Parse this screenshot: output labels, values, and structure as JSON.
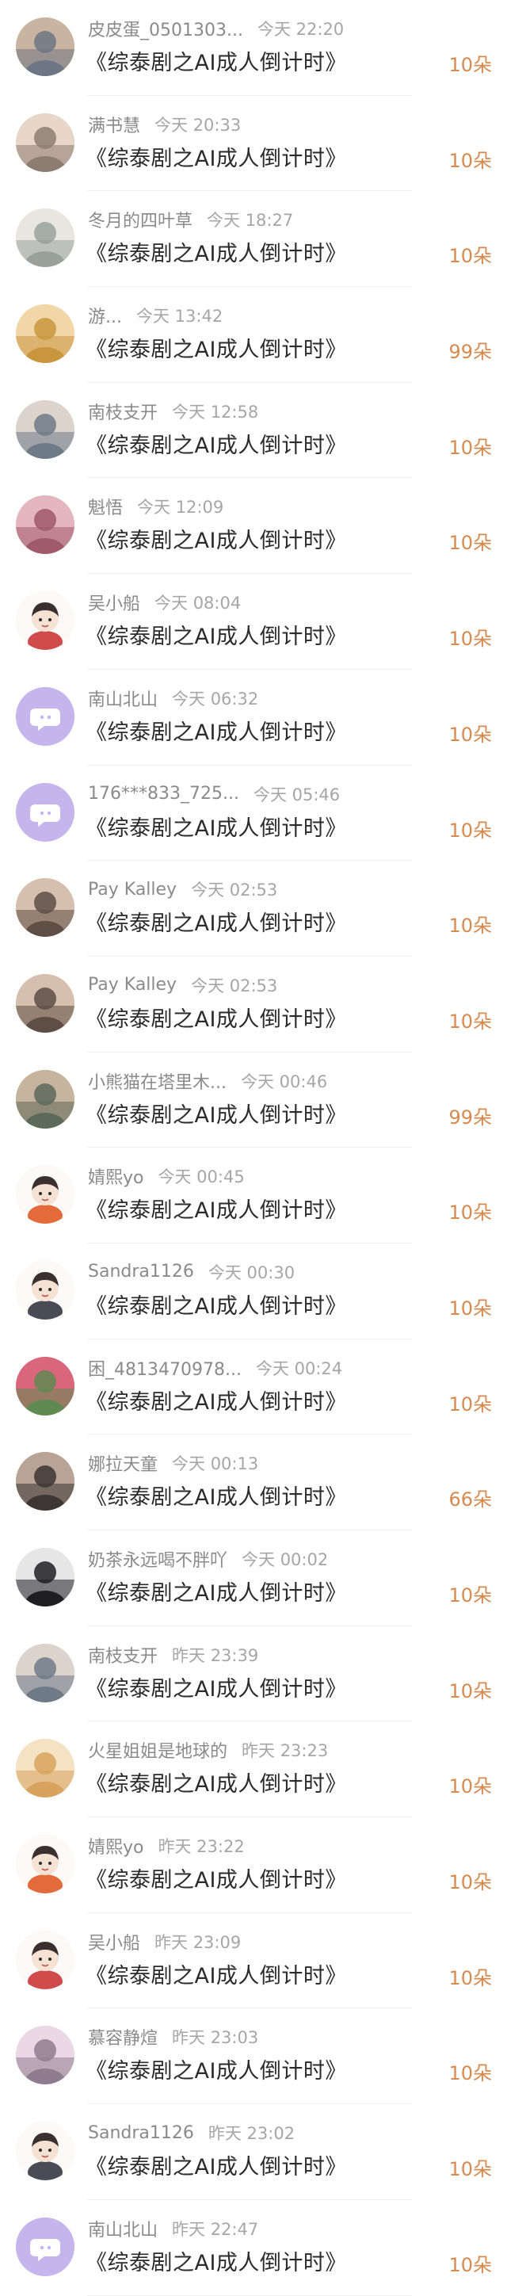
{
  "gift_list": [
    {
      "name": "皮皮蛋_0501303...",
      "time": "今天 22:20",
      "message": "《综泰剧之AI成人倒计时》",
      "count": "10朵",
      "avatar": "photo",
      "color": "#6d7684",
      "color2": "#c9b4a1"
    },
    {
      "name": "满书慧",
      "time": "今天 20:33",
      "message": "《综泰剧之AI成人倒计时》",
      "count": "10朵",
      "avatar": "photo",
      "color": "#8c7c72",
      "color2": "#e8d6c8"
    },
    {
      "name": "冬月的四叶草",
      "time": "今天 18:27",
      "message": "《综泰剧之AI成人倒计时》",
      "count": "10朵",
      "avatar": "photo",
      "color": "#9aa19c",
      "color2": "#e9e6e0"
    },
    {
      "name": "游...",
      "time": "今天 13:42",
      "message": "《综泰剧之AI成人倒计时》",
      "count": "99朵",
      "avatar": "photo",
      "color": "#c9963e",
      "color2": "#f1d7a8"
    },
    {
      "name": "南枝支开",
      "time": "今天 12:58",
      "message": "《综泰剧之AI成人倒计时》",
      "count": "10朵",
      "avatar": "photo",
      "color": "#6f7a88",
      "color2": "#dcd3cc"
    },
    {
      "name": "魁悟",
      "time": "今天 12:09",
      "message": "《综泰剧之AI成人倒计时》",
      "count": "10朵",
      "avatar": "photo",
      "color": "#a05a6a",
      "color2": "#e4b7c0"
    },
    {
      "name": "吴小船",
      "time": "今天 08:04",
      "message": "《综泰剧之AI成人倒计时》",
      "count": "10朵",
      "avatar": "cartoon",
      "color": "#f4f1ee",
      "color2": "#d04b4b"
    },
    {
      "name": "南山北山",
      "time": "今天 06:32",
      "message": "《综泰剧之AI成人倒计时》",
      "count": "10朵",
      "avatar": "default",
      "color": "#c6b4ec",
      "color2": "#ffffff"
    },
    {
      "name": "176***833_725...",
      "time": "今天 05:46",
      "message": "《综泰剧之AI成人倒计时》",
      "count": "10朵",
      "avatar": "default",
      "color": "#c6b4ec",
      "color2": "#ffffff"
    },
    {
      "name": "Pay Kalley",
      "time": "今天 02:53",
      "message": "《综泰剧之AI成人倒计时》",
      "count": "10朵",
      "avatar": "photo",
      "color": "#5e4e46",
      "color2": "#d6bfae"
    },
    {
      "name": "Pay Kalley",
      "time": "今天 02:53",
      "message": "《综泰剧之AI成人倒计时》",
      "count": "10朵",
      "avatar": "photo",
      "color": "#5e4e46",
      "color2": "#d6bfae"
    },
    {
      "name": "小熊猫在塔里木...",
      "time": "今天 00:46",
      "message": "《综泰剧之AI成人倒计时》",
      "count": "99朵",
      "avatar": "photo",
      "color": "#5c6a5a",
      "color2": "#c7b49e"
    },
    {
      "name": "婧熙yo",
      "time": "今天 00:45",
      "message": "《综泰剧之AI成人倒计时》",
      "count": "10朵",
      "avatar": "cartoon",
      "color": "#f8efe6",
      "color2": "#e26a3b"
    },
    {
      "name": "Sandra1126",
      "time": "今天 00:30",
      "message": "《综泰剧之AI成人倒计时》",
      "count": "10朵",
      "avatar": "cartoon",
      "color": "#f3f1ef",
      "color2": "#4b4b57"
    },
    {
      "name": "困_4813470978...",
      "time": "今天 00:24",
      "message": "《综泰剧之AI成人倒计时》",
      "count": "10朵",
      "avatar": "photo",
      "color": "#5f8a52",
      "color2": "#d9667a"
    },
    {
      "name": "娜拉天童",
      "time": "今天 00:13",
      "message": "《综泰剧之AI成人倒计时》",
      "count": "66朵",
      "avatar": "photo",
      "color": "#3c3634",
      "color2": "#b8a396"
    },
    {
      "name": "奶茶永远喝不胖吖",
      "time": "今天 00:02",
      "message": "《综泰剧之AI成人倒计时》",
      "count": "10朵",
      "avatar": "photo",
      "color": "#1f1f22",
      "color2": "#e6e6e6"
    },
    {
      "name": "南枝支开",
      "time": "昨天 23:39",
      "message": "《综泰剧之AI成人倒计时》",
      "count": "10朵",
      "avatar": "photo",
      "color": "#6f7a88",
      "color2": "#dcd3cc"
    },
    {
      "name": "火星姐姐是地球的",
      "time": "昨天 23:23",
      "message": "《综泰剧之AI成人倒计时》",
      "count": "10朵",
      "avatar": "photo",
      "color": "#d7a35e",
      "color2": "#f4e2c3"
    },
    {
      "name": "婧熙yo",
      "time": "昨天 23:22",
      "message": "《综泰剧之AI成人倒计时》",
      "count": "10朵",
      "avatar": "cartoon",
      "color": "#f8efe6",
      "color2": "#e26a3b"
    },
    {
      "name": "吴小船",
      "time": "昨天 23:09",
      "message": "《综泰剧之AI成人倒计时》",
      "count": "10朵",
      "avatar": "cartoon",
      "color": "#f4f1ee",
      "color2": "#d04b4b"
    },
    {
      "name": "慕容静煊",
      "time": "昨天 23:03",
      "message": "《综泰剧之AI成人倒计时》",
      "count": "10朵",
      "avatar": "photo",
      "color": "#8f7c90",
      "color2": "#ead8e4"
    },
    {
      "name": "Sandra1126",
      "time": "昨天 23:02",
      "message": "《综泰剧之AI成人倒计时》",
      "count": "10朵",
      "avatar": "cartoon",
      "color": "#f3f1ef",
      "color2": "#4b4b57"
    },
    {
      "name": "南山北山",
      "time": "昨天 22:47",
      "message": "《综泰剧之AI成人倒计时》",
      "count": "10朵",
      "avatar": "default",
      "color": "#c6b4ec",
      "color2": "#ffffff"
    }
  ]
}
